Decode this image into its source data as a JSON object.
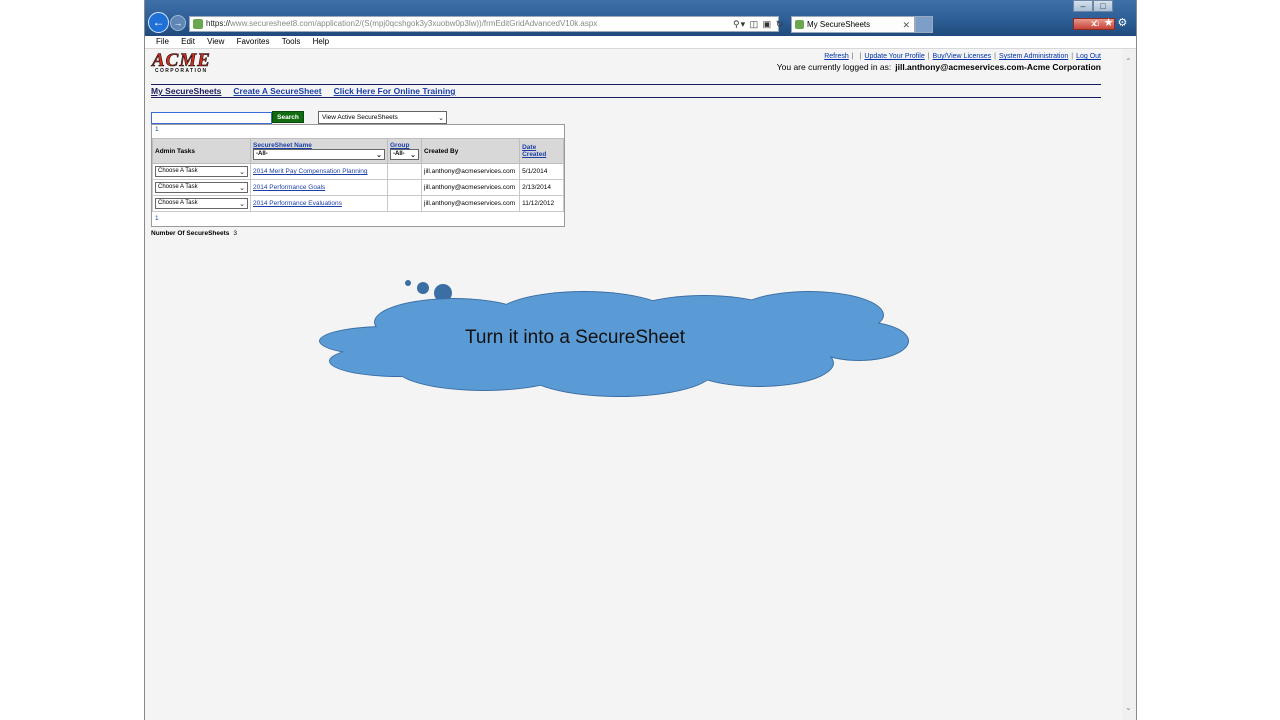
{
  "browser": {
    "url_prefix": "https://",
    "url_domain": "www.securesheet8.com",
    "url_path": "/application2/(S(mpj0qcshgok3y3xuobw0p3lw))/frmEditGridAdvancedV10k.aspx",
    "tab_title": "My SecureSheets",
    "menu": [
      "File",
      "Edit",
      "View",
      "Favorites",
      "Tools",
      "Help"
    ]
  },
  "header": {
    "logo_text": "ACME",
    "logo_subtext": "CORPORATION",
    "links": [
      "Refresh",
      "Update Your Profile",
      "Buy/View Licenses",
      "System Administration",
      "Log Out"
    ],
    "logged_in_label": "You are currently logged in as:",
    "logged_in_user": "jill.anthony@acmeservices.com-Acme Corporation"
  },
  "nav": {
    "my_securesheets": "My SecureSheets",
    "create": "Create A SecureSheet",
    "training": "Click Here For Online Training"
  },
  "search": {
    "button": "Search",
    "view_option": "View Active SecureSheets"
  },
  "grid": {
    "pager": "1",
    "headers": {
      "admin_tasks": "Admin Tasks",
      "name": "SecureSheet Name",
      "name_filter": "-All-",
      "group": "Group",
      "group_filter": "-All-",
      "created_by": "Created By",
      "date_created": "Date Created"
    },
    "rows": [
      {
        "task": "Choose A Task",
        "name": "2014 Merit Pay Compensation Planning",
        "group": "",
        "created_by": "jill.anthony@acmeservices.com",
        "date": "5/1/2014"
      },
      {
        "task": "Choose A Task",
        "name": "2014 Performance Goals",
        "group": "",
        "created_by": "jill.anthony@acmeservices.com",
        "date": "2/13/2014"
      },
      {
        "task": "Choose A Task",
        "name": "2014 Performance Evaluations",
        "group": "",
        "created_by": "jill.anthony@acmeservices.com",
        "date": "11/12/2012"
      }
    ]
  },
  "footer": {
    "count_label": "Number Of SecureSheets",
    "count_value": "3"
  },
  "callout": {
    "text": "Turn it into a SecureSheet",
    "fill_color": "#5b9bd5",
    "stroke_color": "#3b6ea5"
  }
}
